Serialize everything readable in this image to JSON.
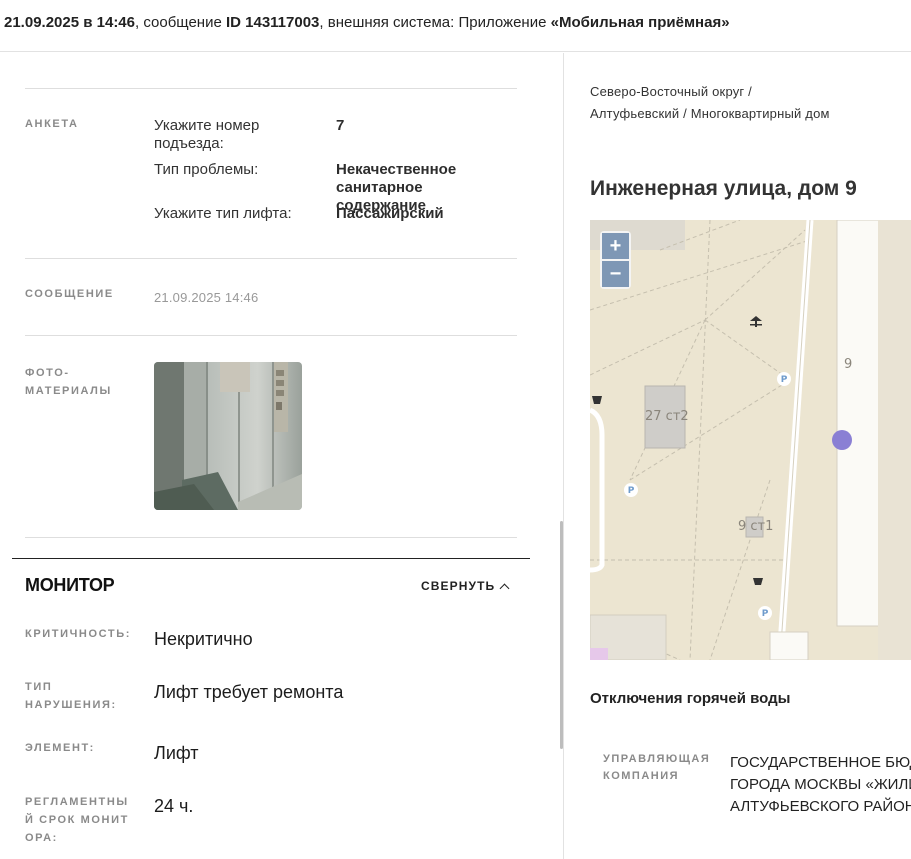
{
  "header": {
    "date_time": "21.09.2025 в 14:46",
    "sep1": ", сообщение ",
    "message_id": "ID 143117003",
    "sep2": ", внешняя система: Приложение ",
    "system_name": "«Мобильная приёмная»"
  },
  "survey": {
    "label": "АНКЕТА",
    "fields": [
      {
        "q": "Укажите номер подъезда:",
        "a": "7"
      },
      {
        "q": "Тип проблемы:",
        "a": "Некачественное санитарное содержание"
      },
      {
        "q": "Укажите тип лифта:",
        "a": "Пассажирский"
      }
    ]
  },
  "message": {
    "label": "СООБЩЕНИЕ",
    "date": "21.09.2025 14:46"
  },
  "photos": {
    "label": "ФОТО-МАТЕРИАЛЫ"
  },
  "monitor": {
    "title": "МОНИТОР",
    "collapse_label": "СВЕРНУТЬ",
    "rows": [
      {
        "label": "КРИТИЧНОСТЬ:",
        "value": "Некритично"
      },
      {
        "label": "ТИП НАРУШЕНИЯ:",
        "value": "Лифт требует ремонта"
      },
      {
        "label": "ЭЛЕМЕНТ:",
        "value": "Лифт"
      },
      {
        "label": "РЕГЛАМЕНТНЫЙ СРОК МОНИТОРА:",
        "value": "24 ч."
      }
    ]
  },
  "location": {
    "breadcrumb": "Северо-Восточный округ / Алтуфьевский / Многоквартирный дом",
    "address": "Инженерная улица, дом 9"
  },
  "map": {
    "zoom_in": "+",
    "zoom_out": "−",
    "labels": {
      "b1": "27 ст2",
      "b2": "9 ст1",
      "b3": "9"
    },
    "parking": "P",
    "marker_color": "#8a7fd4"
  },
  "hot_water": {
    "title": "Отключения горячей воды"
  },
  "management": {
    "label": "УПРАВЛЯЮЩАЯ КОМПАНИЯ",
    "lines": [
      "ГОСУДАРСТВЕННОЕ БЮД",
      "ГОРОДА МОСКВЫ «ЖИЛИ",
      "АЛТУФЬЕВСКОГО РАЙОНА"
    ]
  }
}
